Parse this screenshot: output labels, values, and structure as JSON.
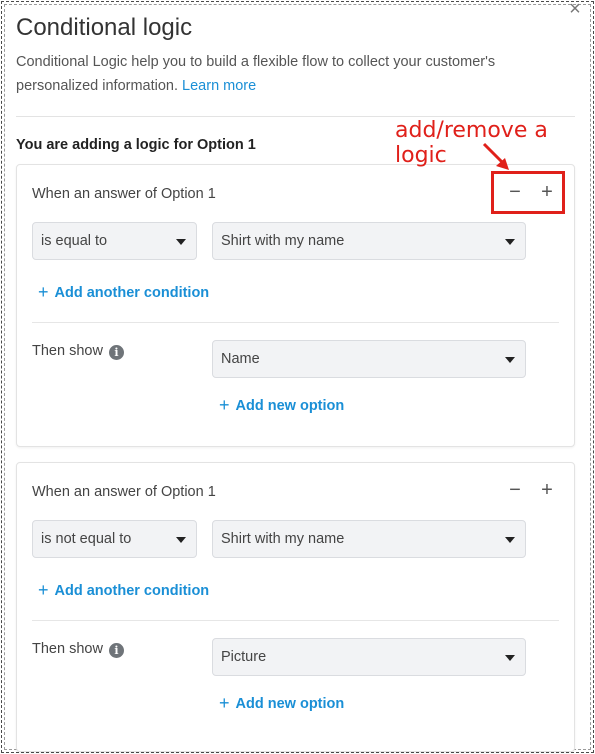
{
  "dialog": {
    "title": "Conditional logic",
    "description": "Conditional Logic help you to build a flexible flow to collect your customer's personalized information.",
    "learn_more": "Learn more",
    "close_glyph": "×",
    "subtitle": "You are adding a logic for Option 1"
  },
  "annotation": {
    "text": "add/remove a logic",
    "color": "#e0201a"
  },
  "icons": {
    "minus": "−",
    "plus": "+",
    "info": "i"
  },
  "rules": [
    {
      "when_label": "When an answer of Option 1",
      "operator": "is equal to",
      "value": "Shirt with my name",
      "add_condition": "Add another condition",
      "then_show_label": "Then show",
      "then_show_value": "Name",
      "add_option": "Add new option"
    },
    {
      "when_label": "When an answer of Option 1",
      "operator": "is not equal to",
      "value": "Shirt with my name",
      "add_condition": "Add another condition",
      "then_show_label": "Then show",
      "then_show_value": "Picture",
      "add_option": "Add new option"
    }
  ],
  "colors": {
    "link": "#1a8fd6",
    "select_bg": "#f2f3f5"
  }
}
